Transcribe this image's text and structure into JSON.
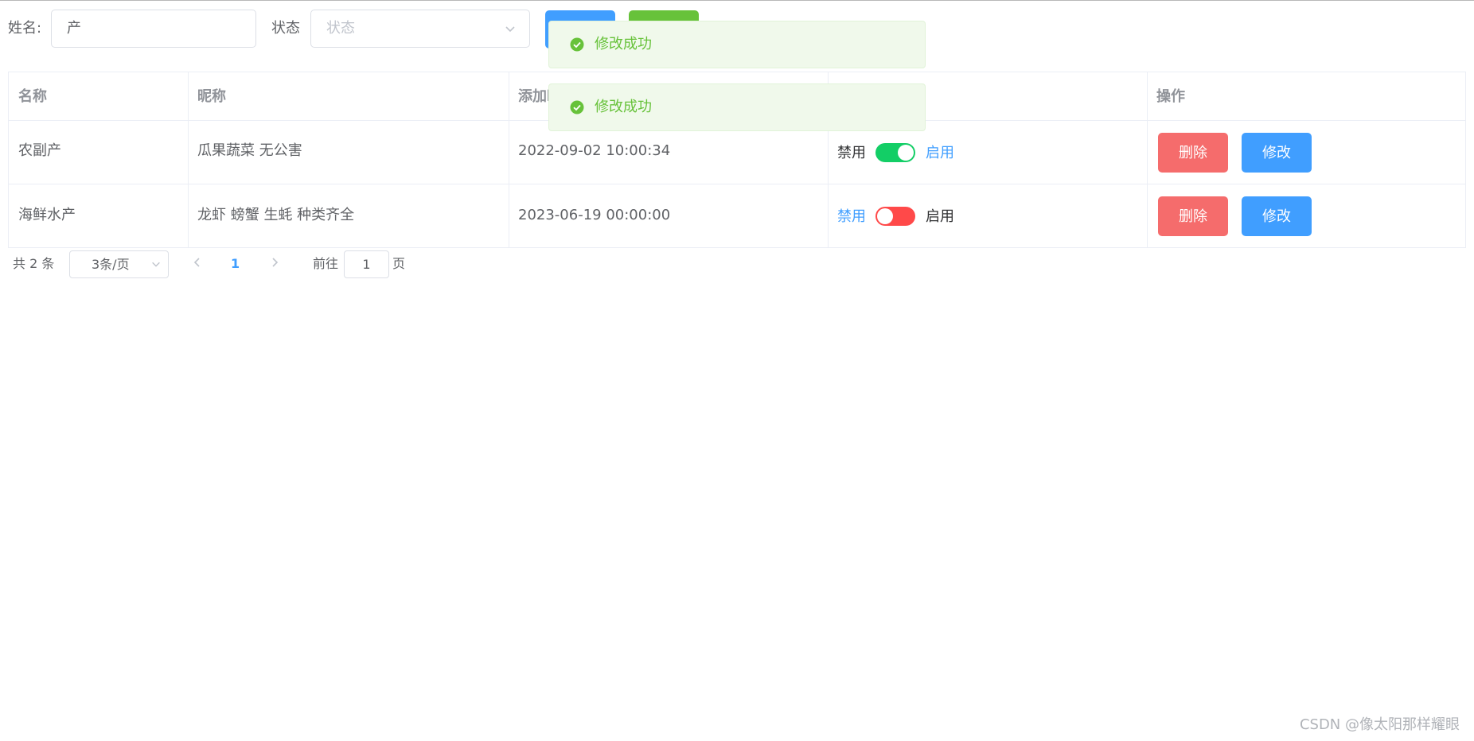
{
  "filter": {
    "name_label": "姓名:",
    "name_value": "产",
    "status_label": "状态",
    "status_placeholder": "状态"
  },
  "table": {
    "columns": [
      "名称",
      "昵称",
      "添加时",
      "",
      "操作"
    ],
    "rows": [
      {
        "name": "农副产",
        "nickname": "瓜果蔬菜 无公害",
        "time": "2022-09-02 10:00:34",
        "off_label": "禁用",
        "on_label": "启用",
        "enabled": true
      },
      {
        "name": "海鲜水产",
        "nickname": "龙虾 螃蟹 生蚝 种类齐全",
        "time": "2023-06-19 00:00:00",
        "off_label": "禁用",
        "on_label": "启用",
        "enabled": false
      }
    ],
    "delete_label": "删除",
    "edit_label": "修改"
  },
  "pagination": {
    "total": "共 2 条",
    "page_size": "3条/页",
    "current_page": "1",
    "goto_prefix": "前往",
    "goto_value": "1",
    "goto_suffix": "页"
  },
  "toasts": [
    {
      "text": "修改成功"
    },
    {
      "text": "修改成功"
    }
  ],
  "watermark": "CSDN @像太阳那样耀眼",
  "colors": {
    "primary": "#409eff",
    "success": "#67c23a",
    "danger": "#f56c6c",
    "switch_on": "#13ce66",
    "switch_off": "#ff4949"
  }
}
